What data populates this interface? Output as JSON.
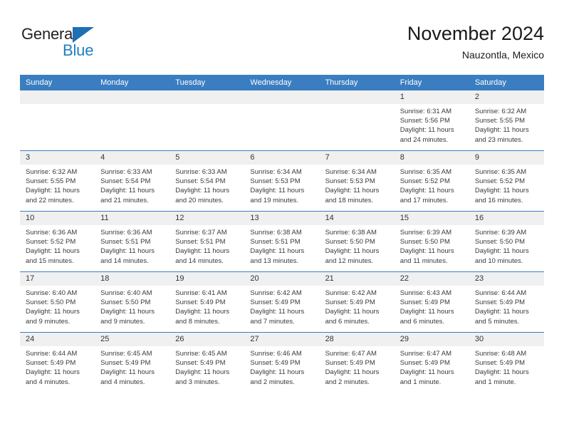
{
  "brand": {
    "name_part1": "General",
    "name_part2": "Blue",
    "triangle_icon": "triangle-icon",
    "primary_color": "#1f7fc4",
    "dark_color": "#231f20"
  },
  "header": {
    "month_title": "November 2024",
    "location": "Nauzontla, Mexico"
  },
  "calendar": {
    "header_color": "#3a7ec1",
    "daynum_bg": "#f0f0f0",
    "weekday_headers": [
      "Sunday",
      "Monday",
      "Tuesday",
      "Wednesday",
      "Thursday",
      "Friday",
      "Saturday"
    ],
    "weeks": [
      [
        {
          "day": "",
          "empty": true
        },
        {
          "day": "",
          "empty": true
        },
        {
          "day": "",
          "empty": true
        },
        {
          "day": "",
          "empty": true
        },
        {
          "day": "",
          "empty": true
        },
        {
          "day": "1",
          "sunrise": "Sunrise: 6:31 AM",
          "sunset": "Sunset: 5:56 PM",
          "daylight": "Daylight: 11 hours and 24 minutes."
        },
        {
          "day": "2",
          "sunrise": "Sunrise: 6:32 AM",
          "sunset": "Sunset: 5:55 PM",
          "daylight": "Daylight: 11 hours and 23 minutes."
        }
      ],
      [
        {
          "day": "3",
          "sunrise": "Sunrise: 6:32 AM",
          "sunset": "Sunset: 5:55 PM",
          "daylight": "Daylight: 11 hours and 22 minutes."
        },
        {
          "day": "4",
          "sunrise": "Sunrise: 6:33 AM",
          "sunset": "Sunset: 5:54 PM",
          "daylight": "Daylight: 11 hours and 21 minutes."
        },
        {
          "day": "5",
          "sunrise": "Sunrise: 6:33 AM",
          "sunset": "Sunset: 5:54 PM",
          "daylight": "Daylight: 11 hours and 20 minutes."
        },
        {
          "day": "6",
          "sunrise": "Sunrise: 6:34 AM",
          "sunset": "Sunset: 5:53 PM",
          "daylight": "Daylight: 11 hours and 19 minutes."
        },
        {
          "day": "7",
          "sunrise": "Sunrise: 6:34 AM",
          "sunset": "Sunset: 5:53 PM",
          "daylight": "Daylight: 11 hours and 18 minutes."
        },
        {
          "day": "8",
          "sunrise": "Sunrise: 6:35 AM",
          "sunset": "Sunset: 5:52 PM",
          "daylight": "Daylight: 11 hours and 17 minutes."
        },
        {
          "day": "9",
          "sunrise": "Sunrise: 6:35 AM",
          "sunset": "Sunset: 5:52 PM",
          "daylight": "Daylight: 11 hours and 16 minutes."
        }
      ],
      [
        {
          "day": "10",
          "sunrise": "Sunrise: 6:36 AM",
          "sunset": "Sunset: 5:52 PM",
          "daylight": "Daylight: 11 hours and 15 minutes."
        },
        {
          "day": "11",
          "sunrise": "Sunrise: 6:36 AM",
          "sunset": "Sunset: 5:51 PM",
          "daylight": "Daylight: 11 hours and 14 minutes."
        },
        {
          "day": "12",
          "sunrise": "Sunrise: 6:37 AM",
          "sunset": "Sunset: 5:51 PM",
          "daylight": "Daylight: 11 hours and 14 minutes."
        },
        {
          "day": "13",
          "sunrise": "Sunrise: 6:38 AM",
          "sunset": "Sunset: 5:51 PM",
          "daylight": "Daylight: 11 hours and 13 minutes."
        },
        {
          "day": "14",
          "sunrise": "Sunrise: 6:38 AM",
          "sunset": "Sunset: 5:50 PM",
          "daylight": "Daylight: 11 hours and 12 minutes."
        },
        {
          "day": "15",
          "sunrise": "Sunrise: 6:39 AM",
          "sunset": "Sunset: 5:50 PM",
          "daylight": "Daylight: 11 hours and 11 minutes."
        },
        {
          "day": "16",
          "sunrise": "Sunrise: 6:39 AM",
          "sunset": "Sunset: 5:50 PM",
          "daylight": "Daylight: 11 hours and 10 minutes."
        }
      ],
      [
        {
          "day": "17",
          "sunrise": "Sunrise: 6:40 AM",
          "sunset": "Sunset: 5:50 PM",
          "daylight": "Daylight: 11 hours and 9 minutes."
        },
        {
          "day": "18",
          "sunrise": "Sunrise: 6:40 AM",
          "sunset": "Sunset: 5:50 PM",
          "daylight": "Daylight: 11 hours and 9 minutes."
        },
        {
          "day": "19",
          "sunrise": "Sunrise: 6:41 AM",
          "sunset": "Sunset: 5:49 PM",
          "daylight": "Daylight: 11 hours and 8 minutes."
        },
        {
          "day": "20",
          "sunrise": "Sunrise: 6:42 AM",
          "sunset": "Sunset: 5:49 PM",
          "daylight": "Daylight: 11 hours and 7 minutes."
        },
        {
          "day": "21",
          "sunrise": "Sunrise: 6:42 AM",
          "sunset": "Sunset: 5:49 PM",
          "daylight": "Daylight: 11 hours and 6 minutes."
        },
        {
          "day": "22",
          "sunrise": "Sunrise: 6:43 AM",
          "sunset": "Sunset: 5:49 PM",
          "daylight": "Daylight: 11 hours and 6 minutes."
        },
        {
          "day": "23",
          "sunrise": "Sunrise: 6:44 AM",
          "sunset": "Sunset: 5:49 PM",
          "daylight": "Daylight: 11 hours and 5 minutes."
        }
      ],
      [
        {
          "day": "24",
          "sunrise": "Sunrise: 6:44 AM",
          "sunset": "Sunset: 5:49 PM",
          "daylight": "Daylight: 11 hours and 4 minutes."
        },
        {
          "day": "25",
          "sunrise": "Sunrise: 6:45 AM",
          "sunset": "Sunset: 5:49 PM",
          "daylight": "Daylight: 11 hours and 4 minutes."
        },
        {
          "day": "26",
          "sunrise": "Sunrise: 6:45 AM",
          "sunset": "Sunset: 5:49 PM",
          "daylight": "Daylight: 11 hours and 3 minutes."
        },
        {
          "day": "27",
          "sunrise": "Sunrise: 6:46 AM",
          "sunset": "Sunset: 5:49 PM",
          "daylight": "Daylight: 11 hours and 2 minutes."
        },
        {
          "day": "28",
          "sunrise": "Sunrise: 6:47 AM",
          "sunset": "Sunset: 5:49 PM",
          "daylight": "Daylight: 11 hours and 2 minutes."
        },
        {
          "day": "29",
          "sunrise": "Sunrise: 6:47 AM",
          "sunset": "Sunset: 5:49 PM",
          "daylight": "Daylight: 11 hours and 1 minute."
        },
        {
          "day": "30",
          "sunrise": "Sunrise: 6:48 AM",
          "sunset": "Sunset: 5:49 PM",
          "daylight": "Daylight: 11 hours and 1 minute."
        }
      ]
    ]
  }
}
